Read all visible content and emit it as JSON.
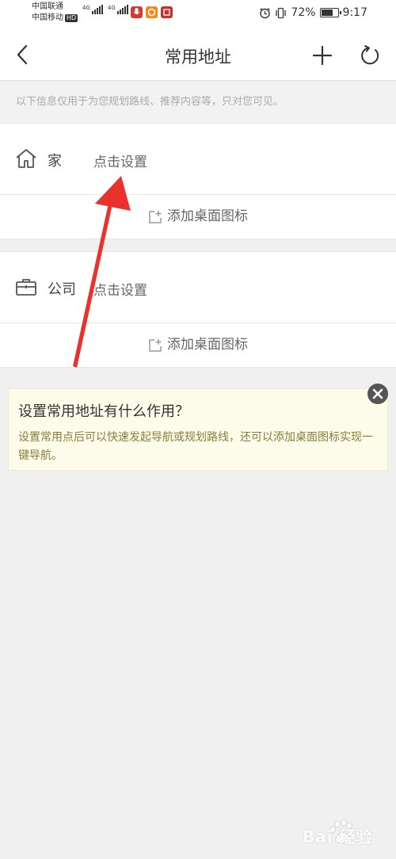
{
  "status_bar": {
    "carrier_1": "中国联通",
    "carrier_2": "中国移动",
    "carrier_2_badge": "HD",
    "signal_labels": [
      "4G",
      "4G"
    ],
    "battery_percent": "72%",
    "battery_level": 0.72,
    "time": "9:17",
    "icons": [
      "mic-app-icon",
      "app-icon-orange",
      "app-icon-red",
      "alarm-icon",
      "vibrate-icon",
      "battery-icon"
    ]
  },
  "header": {
    "title": "常用地址"
  },
  "notice": "以下信息仅用于为您规划路线、推荐内容等，只对您可见。",
  "addresses": [
    {
      "name": "家",
      "action": "点击设置",
      "shortcut": "添加桌面图标",
      "icon": "home-icon"
    },
    {
      "name": "公司",
      "action": "点击设置",
      "shortcut": "添加桌面图标",
      "icon": "briefcase-icon"
    }
  ],
  "help": {
    "title": "设置常用地址有什么作用？",
    "body": "设置常用点后可以快速发起导航或规划路线，还可以添加桌面图标实现一键导航。"
  },
  "watermark": "Bai 经验",
  "colors": {
    "background": "#f0f0f0",
    "help_bg": "#fdfbea",
    "help_text": "#8a7d3a",
    "annotation_arrow": "#e8322b"
  }
}
